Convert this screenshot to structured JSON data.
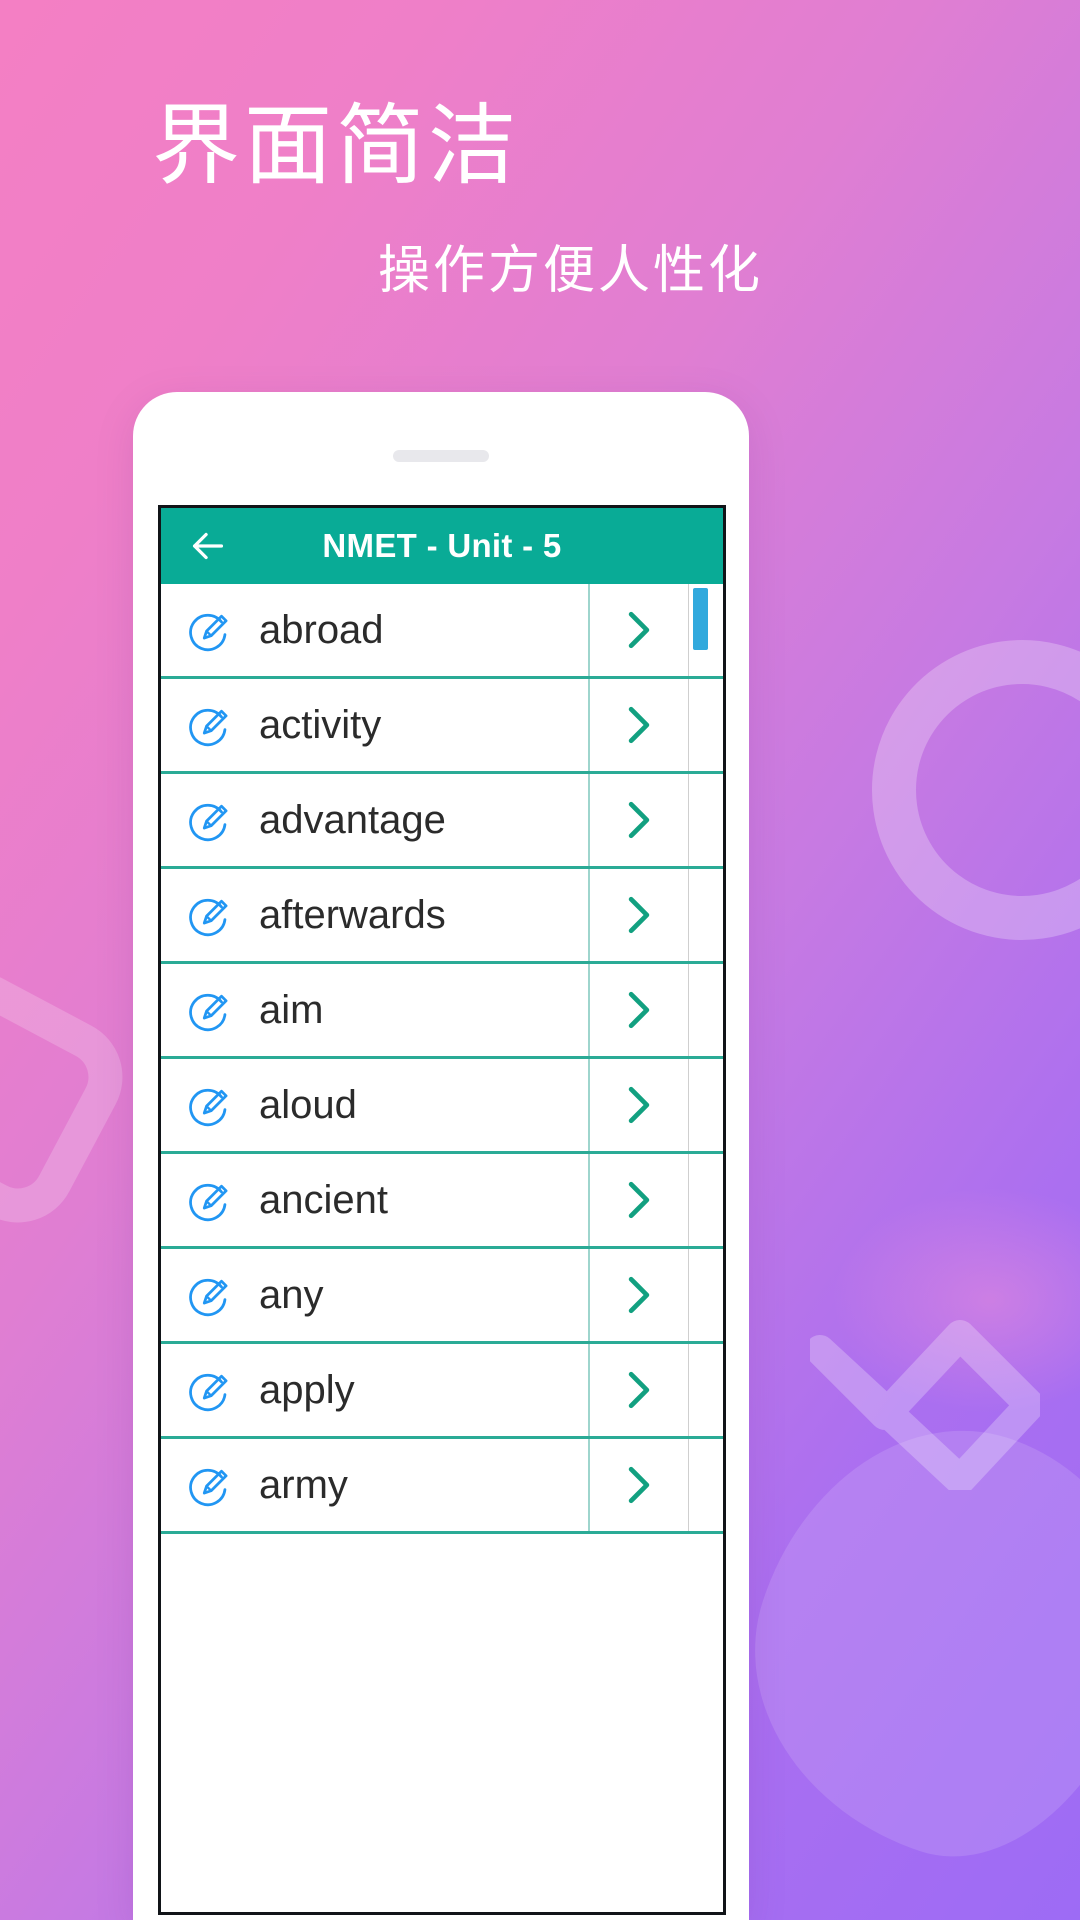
{
  "poster": {
    "headline": "界面简洁",
    "subheadline": "操作方便人性化",
    "gradient_from": "#f47fc4",
    "gradient_to": "#9d6bf5"
  },
  "app": {
    "accent_teal": "#09ab96",
    "divider_teal": "#2aab96",
    "icon_blue": "#2196f3",
    "scrollbar_blue": "#31a9dd",
    "appbar": {
      "back_icon": "back-arrow-icon",
      "title": "NMET - Unit - 5"
    },
    "list": {
      "row_icon": "edit-pencil-circle-icon",
      "row_chevron": "chevron-right-icon",
      "scrollbar": "vertical-scrollbar",
      "items": [
        {
          "word": "abroad"
        },
        {
          "word": "activity"
        },
        {
          "word": "advantage"
        },
        {
          "word": "afterwards"
        },
        {
          "word": "aim"
        },
        {
          "word": "aloud"
        },
        {
          "word": "ancient"
        },
        {
          "word": "any"
        },
        {
          "word": "apply"
        },
        {
          "word": "army"
        }
      ]
    }
  }
}
